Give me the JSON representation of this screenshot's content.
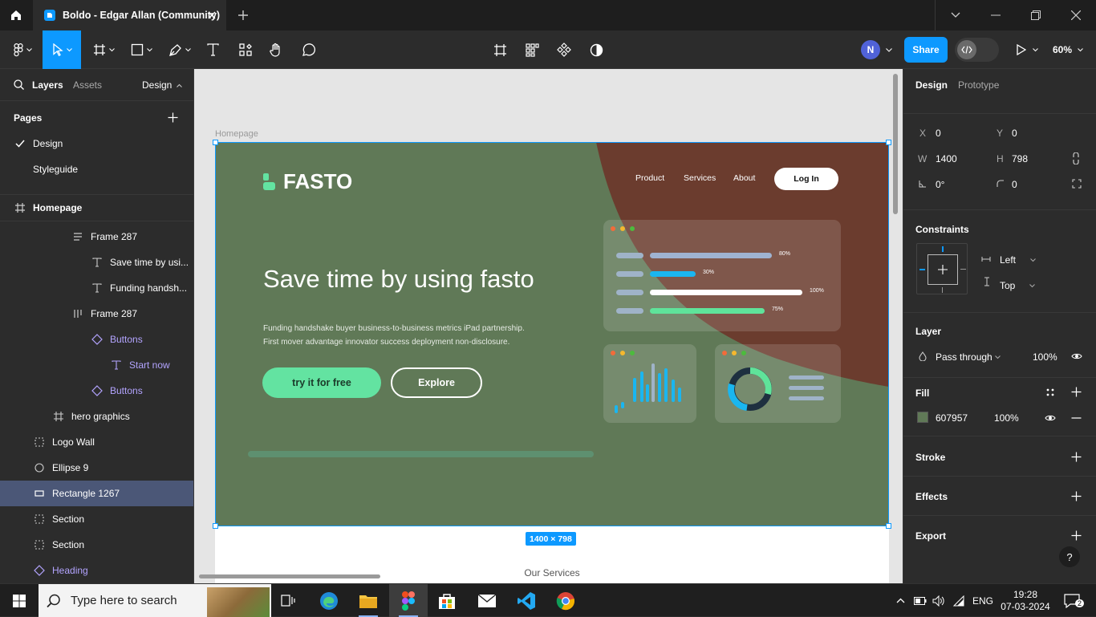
{
  "titlebar": {
    "tab_title": "Boldo - Edgar Allan (Community)",
    "icons": [
      "home-icon",
      "figma-file-icon",
      "close-icon",
      "plus-icon",
      "chevron-down-icon",
      "minimize-icon",
      "restore-icon",
      "close-window-icon"
    ]
  },
  "toolbar": {
    "avatar_initial": "N",
    "share_label": "Share",
    "zoom_label": "60%",
    "tools": [
      "main-menu",
      "move",
      "frame",
      "shape",
      "pen",
      "text",
      "resources",
      "hand",
      "comment",
      "crop",
      "grid",
      "component",
      "contrast",
      "devmode",
      "present"
    ]
  },
  "left_panel": {
    "tab_layers": "Layers",
    "tab_assets": "Assets",
    "page_dropdown": "Design",
    "pages_title": "Pages",
    "pages": [
      {
        "name": "Design",
        "current": true
      },
      {
        "name": "Styleguide",
        "current": false
      }
    ],
    "layers": [
      {
        "name": "Homepage",
        "icon": "frame-icon",
        "bold": true
      },
      {
        "name": "Frame 287",
        "icon": "auto-layout-vertical-icon"
      },
      {
        "name": "Save time by usi...",
        "icon": "text-icon"
      },
      {
        "name": "Funding handsh...",
        "icon": "text-icon"
      },
      {
        "name": "Frame 287",
        "icon": "auto-layout-horizontal-icon"
      },
      {
        "name": "Buttons",
        "icon": "component-instance-icon",
        "component": true
      },
      {
        "name": "Start now",
        "icon": "text-icon",
        "component": true
      },
      {
        "name": "Buttons",
        "icon": "component-instance-icon",
        "component": true
      },
      {
        "name": "hero graphics",
        "icon": "frame-icon"
      },
      {
        "name": "Logo Wall",
        "icon": "section-icon"
      },
      {
        "name": "Ellipse 9",
        "icon": "ellipse-icon"
      },
      {
        "name": "Rectangle 1267",
        "icon": "rectangle-icon",
        "selected": true
      },
      {
        "name": "Section",
        "icon": "section-icon"
      },
      {
        "name": "Section",
        "icon": "section-icon"
      },
      {
        "name": "Heading",
        "icon": "component-instance-icon",
        "component": true
      }
    ]
  },
  "canvas": {
    "frame_label": "Homepage",
    "size_badge": "1400 × 798",
    "below_text": "Our Services",
    "hero": {
      "logo_text": "FASTO",
      "nav": [
        "Product",
        "Services",
        "About"
      ],
      "login": "Log In",
      "headline": "Save time by using fasto",
      "paragraph_line1": "Funding handshake buyer business-to-business metrics iPad partnership.",
      "paragraph_line2": "First mover advantage innovator success deployment non-disclosure.",
      "cta_primary": "try it for free",
      "cta_secondary": "Explore",
      "progress_bars": [
        {
          "label": "80%",
          "value": 0.8,
          "color": "#9fb3d1"
        },
        {
          "label": "30%",
          "value": 0.3,
          "color": "#1ab6f0"
        },
        {
          "label": "100%",
          "value": 1.0,
          "color": "#ffffff"
        },
        {
          "label": "75%",
          "value": 0.75,
          "color": "#5fe39a"
        }
      ],
      "colors": {
        "bg": "#607957",
        "accent": "#63e3a1",
        "brown": "#6b3c2e"
      }
    }
  },
  "right_panel": {
    "tab_design": "Design",
    "tab_prototype": "Prototype",
    "x_label": "X",
    "x_value": "0",
    "y_label": "Y",
    "y_value": "0",
    "w_label": "W",
    "w_value": "1400",
    "h_label": "H",
    "h_value": "798",
    "rotation": "0°",
    "radius": "0",
    "constraints_title": "Constraints",
    "constraint_h": "Left",
    "constraint_v": "Top",
    "layer_title": "Layer",
    "blend_mode": "Pass through",
    "layer_opacity": "100%",
    "fill_title": "Fill",
    "fill_hex": "607957",
    "fill_opacity": "100%",
    "fill_color": "#607957",
    "stroke_title": "Stroke",
    "effects_title": "Effects",
    "export_title": "Export",
    "help": "?"
  },
  "taskbar": {
    "search_placeholder": "Type here to search",
    "language": "ENG",
    "time": "19:28",
    "date": "07-03-2024",
    "notification_count": "2"
  }
}
